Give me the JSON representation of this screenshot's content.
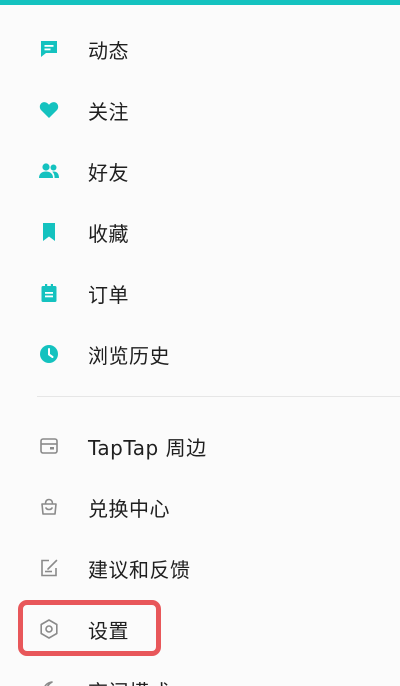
{
  "menu": {
    "items": [
      {
        "label": "动态",
        "icon": "feed-icon"
      },
      {
        "label": "关注",
        "icon": "heart-icon"
      },
      {
        "label": "好友",
        "icon": "friends-icon"
      },
      {
        "label": "收藏",
        "icon": "bookmark-icon"
      },
      {
        "label": "订单",
        "icon": "order-icon"
      },
      {
        "label": "浏览历史",
        "icon": "history-icon"
      }
    ],
    "secondary_items": [
      {
        "label": "TapTap 周边",
        "icon": "shop-icon"
      },
      {
        "label": "兑换中心",
        "icon": "redeem-icon"
      },
      {
        "label": "建议和反馈",
        "icon": "feedback-icon"
      },
      {
        "label": "设置",
        "icon": "settings-icon"
      },
      {
        "label": "夜间模式",
        "icon": "night-mode-icon"
      }
    ]
  },
  "colors": {
    "accent": "#14c2bf",
    "highlight": "#e8575a",
    "text": "#1f1f1f",
    "icon_secondary": "#8a8a8a"
  }
}
